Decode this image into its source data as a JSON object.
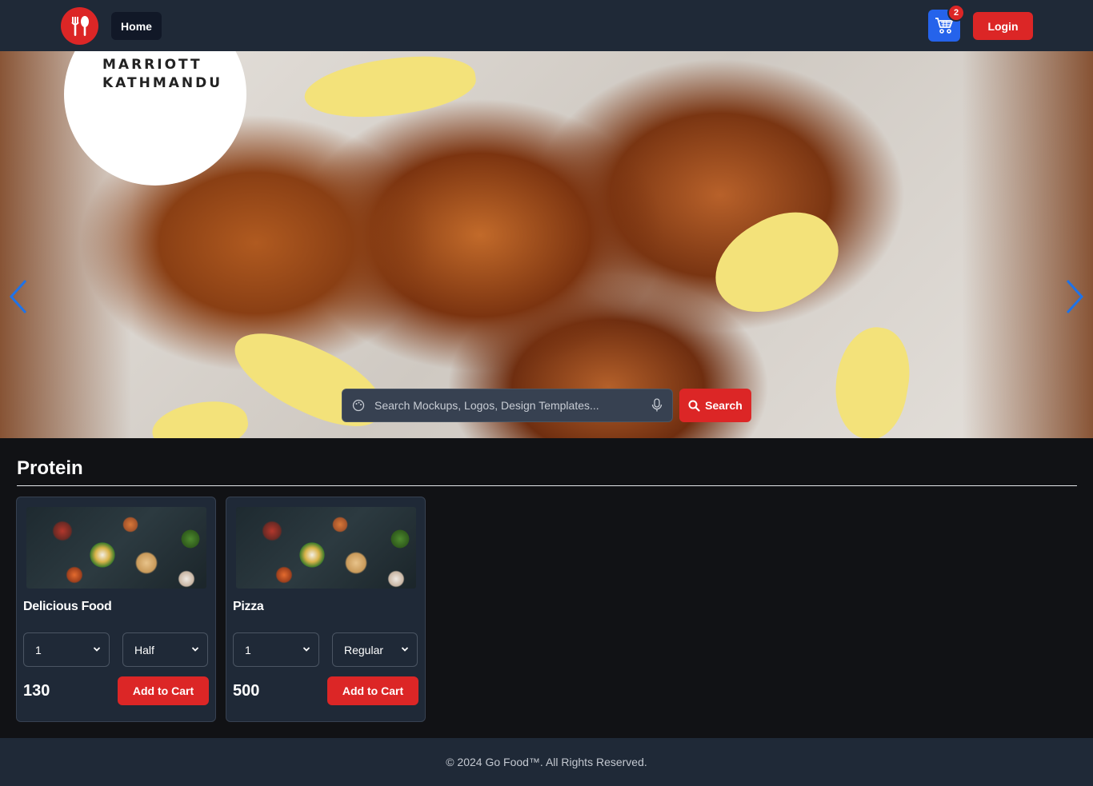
{
  "navbar": {
    "logo_icon": "fork-knife-icon",
    "home_label": "Home",
    "cart_icon": "cart-icon",
    "cart_count": "2",
    "login_label": "Login"
  },
  "hero": {
    "brand_text": "MARRIOTT\nKATHMANDU",
    "prev_icon": "chevron-left-icon",
    "next_icon": "chevron-right-icon",
    "search": {
      "placeholder": "Search Mockups, Logos, Design Templates...",
      "value": "",
      "button_label": "Search"
    }
  },
  "category": {
    "title": "Protein",
    "items": [
      {
        "name": "Delicious Food",
        "quantity": "1",
        "size": "Half",
        "price": "130",
        "button_label": "Add to Cart"
      },
      {
        "name": "Pizza",
        "quantity": "1",
        "size": "Regular",
        "price": "500",
        "button_label": "Add to Cart"
      }
    ]
  },
  "footer": {
    "text": "© 2024 Go Food™. All Rights Reserved."
  },
  "colors": {
    "accent": "#dc2626",
    "cart": "#2563eb",
    "navbar": "#1f2937",
    "page": "#111215"
  }
}
